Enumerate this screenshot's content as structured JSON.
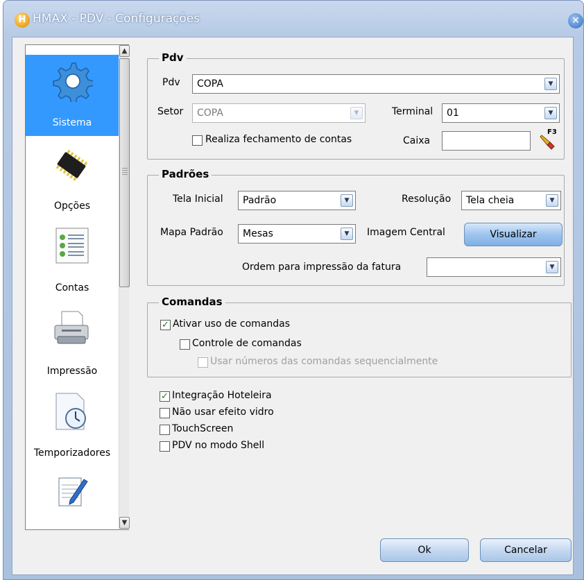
{
  "window": {
    "title": "HMAX - PDV - Configurações",
    "app_icon_letter": "H",
    "close_glyph": "✕"
  },
  "sidebar": {
    "items": [
      {
        "label": "Sistema",
        "icon": "gear-icon",
        "selected": true
      },
      {
        "label": "Opções",
        "icon": "chip-icon"
      },
      {
        "label": "Contas",
        "icon": "list-icon"
      },
      {
        "label": "Impressão",
        "icon": "printer-icon"
      },
      {
        "label": "Temporizadores",
        "icon": "timer-icon"
      },
      {
        "label": "",
        "icon": "notepad-icon"
      }
    ],
    "scroll_up": "▲",
    "scroll_down": "▼"
  },
  "pdv": {
    "title": "Pdv",
    "pdv_label": "Pdv",
    "pdv_value": "COPA",
    "setor_label": "Setor",
    "setor_value": "COPA",
    "terminal_label": "Terminal",
    "terminal_value": "01",
    "fechamento_label": "Realiza fechamento de contas",
    "fechamento_checked": false,
    "caixa_label": "Caixa",
    "caixa_value": "",
    "f3_label": "F3"
  },
  "padroes": {
    "title": "Padrões",
    "tela_inicial_label": "Tela Inicial",
    "tela_inicial_value": "Padrão",
    "resolucao_label": "Resolução",
    "resolucao_value": "Tela cheia",
    "mapa_label": "Mapa Padrão",
    "mapa_value": "Mesas",
    "imagem_label": "Imagem Central",
    "visualizar_label": "Visualizar",
    "ordem_label": "Ordem para impressão da fatura",
    "ordem_value": ""
  },
  "comandas": {
    "title": "Comandas",
    "ativar_label": "Ativar uso de comandas",
    "ativar_checked": true,
    "controle_label": "Controle de comandas",
    "controle_checked": false,
    "sequencial_label": "Usar números das comandas sequencialmente",
    "sequencial_checked": false
  },
  "options": {
    "integracao_label": "Integração Hoteleira",
    "integracao_checked": true,
    "vidro_label": "Não usar efeito vidro",
    "vidro_checked": false,
    "touch_label": "TouchScreen",
    "touch_checked": false,
    "shell_label": "PDV no modo Shell",
    "shell_checked": false
  },
  "footer": {
    "ok_label": "Ok",
    "cancel_label": "Cancelar"
  },
  "glyphs": {
    "dropdown": "▼",
    "check": "✓"
  }
}
